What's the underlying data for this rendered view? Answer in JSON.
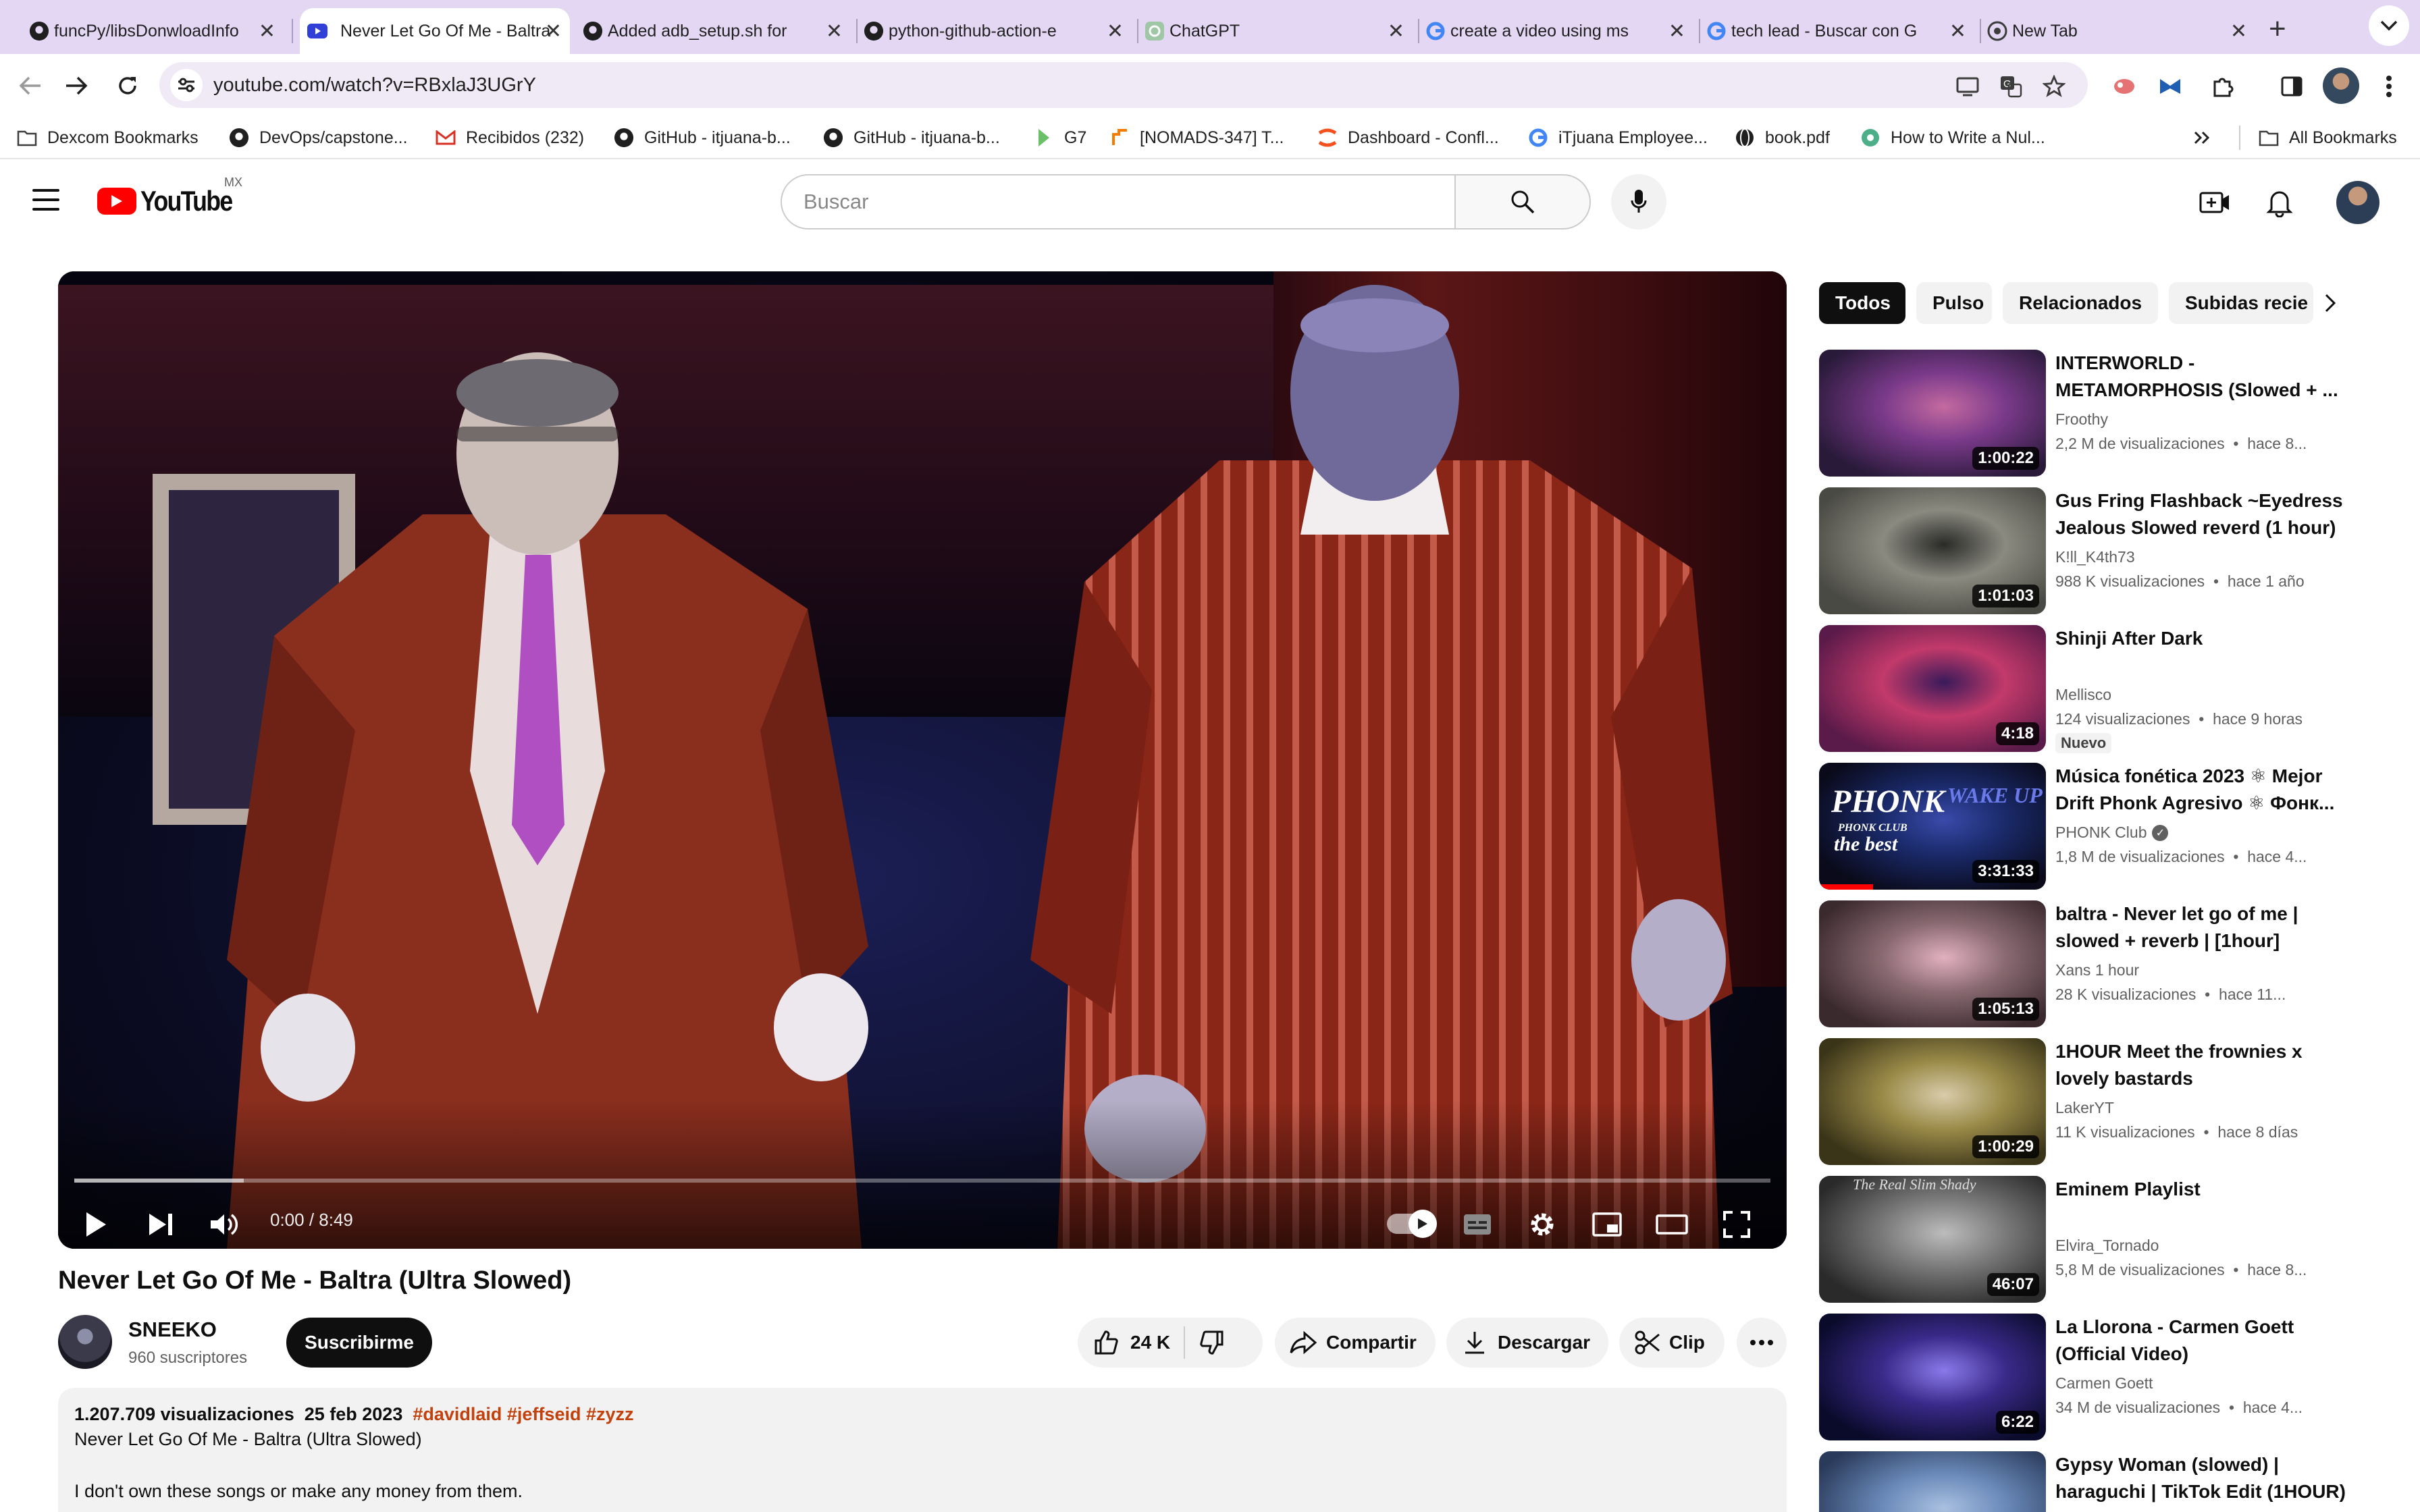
{
  "browser": {
    "tabs": [
      {
        "title": "funcPy/libsDonwloadInfo",
        "icon": "github-icon"
      },
      {
        "title": "Never Let Go Of Me - Baltra",
        "icon": "youtube-icon",
        "active": true
      },
      {
        "title": "Added adb_setup.sh for",
        "icon": "github-icon"
      },
      {
        "title": "python-github-action-e",
        "icon": "github-icon"
      },
      {
        "title": "ChatGPT",
        "icon": "chatgpt-icon"
      },
      {
        "title": "create a video using ms",
        "icon": "google-icon"
      },
      {
        "title": "tech lead - Buscar con G",
        "icon": "google-icon"
      },
      {
        "title": "New Tab",
        "icon": "chrome-icon"
      }
    ],
    "url": "youtube.com/watch?v=RBxlaJ3UGrY",
    "bookmarks": [
      {
        "label": "Dexcom Bookmarks",
        "icon": "folder-icon"
      },
      {
        "label": "DevOps/capstone...",
        "icon": "github-icon"
      },
      {
        "label": "Recibidos (232)",
        "icon": "gmail-icon"
      },
      {
        "label": "GitHub - itjuana-b...",
        "icon": "github-icon"
      },
      {
        "label": "GitHub - itjuana-b...",
        "icon": "github-icon"
      },
      {
        "label": "G7",
        "icon": "g7-icon"
      },
      {
        "label": "[NOMADS-347] T...",
        "icon": "jira-icon"
      },
      {
        "label": "Dashboard - Confl...",
        "icon": "confluence-icon"
      },
      {
        "label": "iTjuana Employee...",
        "icon": "google-icon"
      },
      {
        "label": "book.pdf",
        "icon": "globe-icon"
      },
      {
        "label": "How to Write a Nul...",
        "icon": "site-icon"
      }
    ],
    "all_bookmarks": "All Bookmarks"
  },
  "youtube": {
    "logo": "YouTube",
    "country": "MX",
    "search_placeholder": "Buscar"
  },
  "player": {
    "time": "0:00 / 8:49",
    "progress": 0,
    "buffered_fraction": 0.1
  },
  "video": {
    "title": "Never Let Go Of Me - Baltra (Ultra Slowed)",
    "channel": "SNEEKO",
    "subscribers": "960 suscriptores",
    "subscribe": "Suscribirme",
    "likes": "24 K",
    "share": "Compartir",
    "download": "Descargar",
    "clip": "Clip",
    "views": "1.207.709 visualizaciones",
    "date": "25 feb 2023",
    "tags": "#davidlaid #jeffseid #zyzz",
    "desc_line1": "Never Let Go Of Me - Baltra (Ultra Slowed)",
    "desc_line2": "I don't own these songs or make any money from them."
  },
  "chips": [
    "Todos",
    "Pulso",
    "Relacionados",
    "Subidas recie"
  ],
  "recommendations": [
    {
      "title": "INTERWORLD - METAMORPHOSIS (Slowed + ...",
      "channel": "Froothy",
      "views": "2,2 M de visualizaciones",
      "age": "hace 8...",
      "duration": "1:00:22",
      "colors": [
        "#2a1a3a",
        "#7a3a8a",
        "#c46aa0"
      ]
    },
    {
      "title": "Gus Fring Flashback ~Eyedress Jealous Slowed reverd (1 hour)",
      "channel": "K!ll_K4th73",
      "views": "988 K visualizaciones",
      "age": "hace 1 año",
      "duration": "1:01:03",
      "colors": [
        "#4a4a44",
        "#8a8a80",
        "#2a2a28"
      ]
    },
    {
      "title": "Shinji After Dark",
      "channel": "Mellisco",
      "views": "124 visualizaciones",
      "age": "hace 9 horas",
      "duration": "4:18",
      "badge": "Nuevo",
      "colors": [
        "#5a1a4a",
        "#c23a6a",
        "#3a1a5a"
      ]
    },
    {
      "title": "Música fonética 2023 ⚛ Mejor Drift Phonk Agresivo ⚛ Фонк...",
      "channel": "PHONK Club",
      "verified": true,
      "views": "1,8 M de visualizaciones",
      "age": "hace 4...",
      "duration": "3:31:33",
      "colors": [
        "#0a0a1a",
        "#1a2a6a",
        "#3a4aaa"
      ],
      "thumb_text": [
        "PHONK",
        "PHONK CLUB",
        "the best",
        "WAKE UP"
      ]
    },
    {
      "title": "baltra - Never let go of me | slowed + reverb | [1hour]",
      "channel": "Xans 1 hour",
      "views": "28 K visualizaciones",
      "age": "hace 11...",
      "duration": "1:05:13",
      "colors": [
        "#3a2a2e",
        "#8a6a72",
        "#e2b0c0"
      ]
    },
    {
      "title": "1HOUR Meet the frownies x lovely bastards",
      "channel": "LakerYT",
      "views": "11 K visualizaciones",
      "age": "hace 8 días",
      "duration": "1:00:29",
      "colors": [
        "#3a3418",
        "#9a8a48",
        "#d8ccaa"
      ]
    },
    {
      "title": "Eminem Playlist",
      "channel": "Elvira_Tornado",
      "views": "5,8 M de visualizaciones",
      "age": "hace 8...",
      "duration": "46:07",
      "colors": [
        "#2a2a2a",
        "#7a7a7a",
        "#bcbcbc"
      ],
      "thumb_text": [
        "The Real Slim Shady"
      ]
    },
    {
      "title": "La Llorona - Carmen Goett (Official Video)",
      "channel": "Carmen Goett",
      "views": "34 M de visualizaciones",
      "age": "hace 4...",
      "duration": "6:22",
      "colors": [
        "#0a0a2a",
        "#3a2a8a",
        "#8a7aea"
      ]
    },
    {
      "title": "Gypsy Woman (slowed) | haraguchi | TikTok Edit (1HOUR)",
      "channel": "",
      "views": "",
      "age": "",
      "duration": "",
      "colors": [
        "#2a3a5a",
        "#6a8aba",
        "#aac0e0"
      ]
    }
  ],
  "colors": {
    "accent": "#ff0000",
    "tag": "#c2410c",
    "tabbar": "#e3d7f4",
    "omnibox": "#f0eaf6"
  }
}
